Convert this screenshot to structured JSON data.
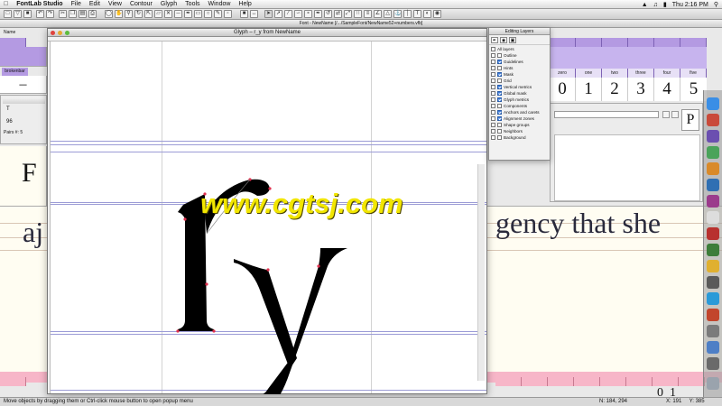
{
  "menubar": {
    "app_name": "FontLab Studio",
    "items": [
      "File",
      "Edit",
      "View",
      "Contour",
      "Glyph",
      "Tools",
      "Window",
      "Help"
    ],
    "clock": "Thu 2:16 PM"
  },
  "font_window": {
    "title": "Font - NewName [/.../SampleFont/NewName52+numbers.vfb]",
    "name_label": "Name",
    "glyph_labels": [
      "zero",
      "one",
      "two",
      "three",
      "four",
      "five"
    ],
    "glyph_chars": [
      "0",
      "1",
      "2",
      "3",
      "4",
      "5"
    ],
    "right_glyph": "P",
    "left_cell_label": "brokenbar",
    "left_glyph": "–"
  },
  "metrics_window": {
    "value": "96",
    "pairs_label": "Pairs #:",
    "pairs_value": "5",
    "sample_text_right": "gency that she",
    "sample_text_left": "aj",
    "sample_big_letter": "F",
    "bottom_digits": "0  1"
  },
  "glyph_window": {
    "title": "Glyph – r_y from NewName",
    "glyph_text": "ry"
  },
  "editing_layers": {
    "title": "Editing Layers",
    "all_layers_label": "All layers",
    "layers": [
      {
        "label": "Outline",
        "checked": false
      },
      {
        "label": "Guidelines",
        "checked": true
      },
      {
        "label": "Hints",
        "checked": false
      },
      {
        "label": "Mask",
        "checked": true
      },
      {
        "label": "Grid",
        "checked": false
      },
      {
        "label": "Vertical metrics",
        "checked": true
      },
      {
        "label": "Global mask",
        "checked": true
      },
      {
        "label": "Glyph metrics",
        "checked": true
      },
      {
        "label": "Components",
        "checked": false
      },
      {
        "label": "Anchors and carets",
        "checked": true
      },
      {
        "label": "Alignment zones",
        "checked": true
      },
      {
        "label": "Shape groups",
        "checked": false
      },
      {
        "label": "Neighbors",
        "checked": false
      },
      {
        "label": "Background",
        "checked": false
      }
    ]
  },
  "statusbar": {
    "hint": "Move objects by dragging them or Ctrl-click mouse button to open popup menu",
    "position": "N: 184, 294",
    "cursor": "X: 191     Y: 385"
  },
  "watermark": "www.cgtsj.com",
  "colors": {
    "header_cell": "#b49ae2",
    "bottom_cell": "#f7b6c8",
    "guide_line": "#9c9cd6",
    "watermark": "#f2e600"
  }
}
